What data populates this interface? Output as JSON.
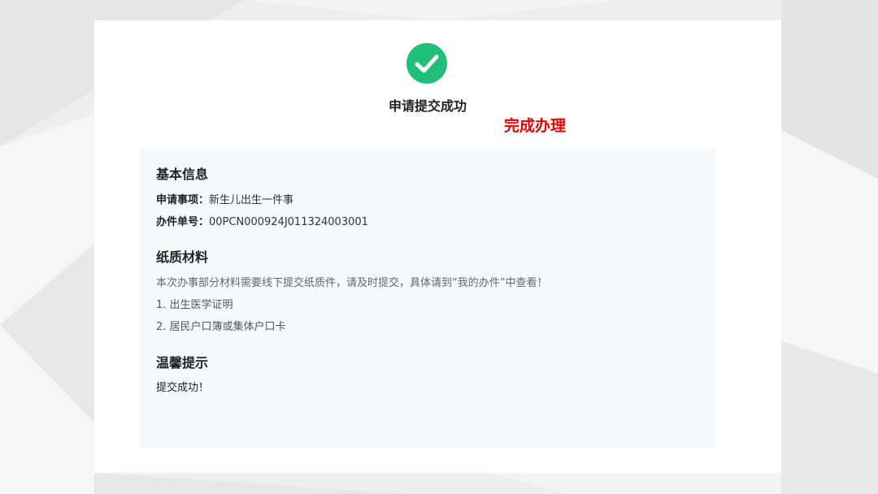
{
  "colors": {
    "success": "#1fbf7a",
    "accent_red": "#ee0000",
    "panel_bg": "#f7f8fa"
  },
  "header": {
    "icon": "check-circle-icon",
    "title": "申请提交成功",
    "done_label": "完成办理"
  },
  "basic_info": {
    "title": "基本信息",
    "item_label": "申请事项：",
    "item_value": "新生儿出生一件事",
    "number_label": "办件单号：",
    "number_value": "00PCN000924J011324003001"
  },
  "paper_materials": {
    "title": "纸质材料",
    "note": "本次办事部分材料需要线下提交纸质件，请及时提交，具体请到“我的办件”中查看！",
    "items": [
      "1. 出生医学证明",
      "2. 居民户口簿或集体户口卡"
    ]
  },
  "tips": {
    "title": "温馨提示",
    "text": "提交成功！"
  }
}
